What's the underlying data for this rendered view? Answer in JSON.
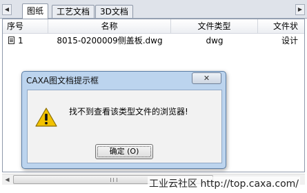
{
  "tabs": {
    "items": [
      "图纸",
      "工艺文档",
      "3D文档"
    ],
    "active": 0
  },
  "table": {
    "columns": [
      "序号",
      "名称",
      "文件类型",
      "文件状"
    ],
    "rows": [
      {
        "index": "1",
        "name": "8015-0200009侧盖板.dwg",
        "type": "dwg",
        "status": "设计"
      }
    ]
  },
  "dialog": {
    "title": "CAXA图文档提示框",
    "close_label": "✕",
    "message": "找不到查看该类型文件的浏览器!",
    "ok_label": "确定 (O)",
    "icon": "warning-icon"
  },
  "watermark": "工业云社区 http://top.caxa.com/",
  "colors": {
    "dialog_frame": "#bcd4ee",
    "warning": "#f2c200"
  }
}
